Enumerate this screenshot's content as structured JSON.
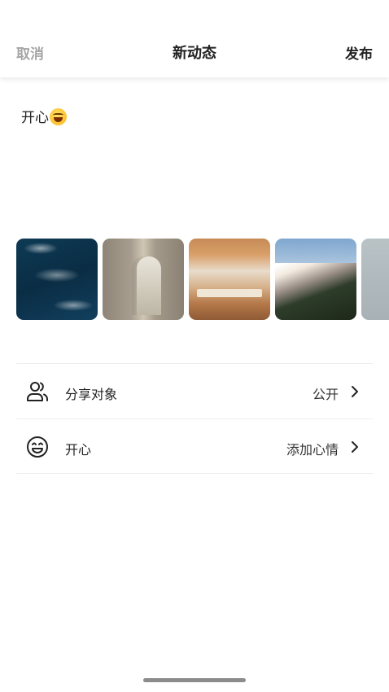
{
  "header": {
    "cancel_label": "取消",
    "title": "新动态",
    "publish_label": "发布"
  },
  "composer": {
    "text": "开心",
    "emoji_icon": "grinning-face-emoji"
  },
  "photos": [
    {
      "icon": "ocean-boats-photo"
    },
    {
      "icon": "arched-doorway-photo"
    },
    {
      "icon": "wooden-interior-photo"
    },
    {
      "icon": "mountain-landscape-photo"
    },
    {
      "icon": "grey-sky-photo"
    }
  ],
  "settings": [
    {
      "icon": "users-icon",
      "label": "分享对象",
      "value": "公开"
    },
    {
      "icon": "smiley-icon",
      "label": "开心",
      "value": "添加心情"
    }
  ],
  "colors": {
    "cancel": "#a5a5a5",
    "text": "#222222",
    "divider": "#eeeeee"
  }
}
